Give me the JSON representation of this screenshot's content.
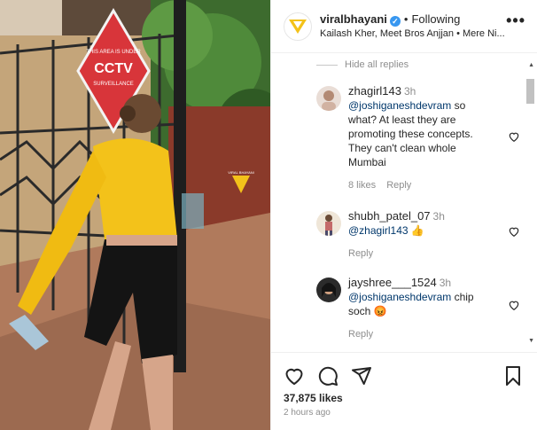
{
  "post": {
    "username": "viralbhayani",
    "follow_status": "Following",
    "audio": "Kailash Kher, Meet Bros Anjjan • Mere Ni...",
    "media": {
      "sign_text_1": "THIS AREA IS UNDER",
      "sign_text_2": "CCTV",
      "sign_text_3": "SURVEILLANCE"
    }
  },
  "comments": {
    "hide_replies_label": "Hide all replies",
    "items": [
      {
        "user": "zhagirl143",
        "time": "3h",
        "mention": "@joshiganeshdevram",
        "text": " so what? At least they are promoting these concepts. They can't clean whole Mumbai",
        "likes": "8 likes",
        "reply": "Reply"
      },
      {
        "user": "shubh_patel_07",
        "time": "3h",
        "mention": "@zhagirl143",
        "text": " 👍",
        "reply": "Reply"
      },
      {
        "user": "jayshree___1524",
        "time": "3h",
        "mention": "@joshiganeshdevram",
        "text": " chip soch 😡",
        "reply": "Reply"
      }
    ]
  },
  "footer": {
    "likes": "37,875 likes",
    "time_ago": "2 hours ago"
  },
  "colors": {
    "mention": "#00376b",
    "verified": "#3897f0",
    "muted": "#8e8e8e"
  }
}
